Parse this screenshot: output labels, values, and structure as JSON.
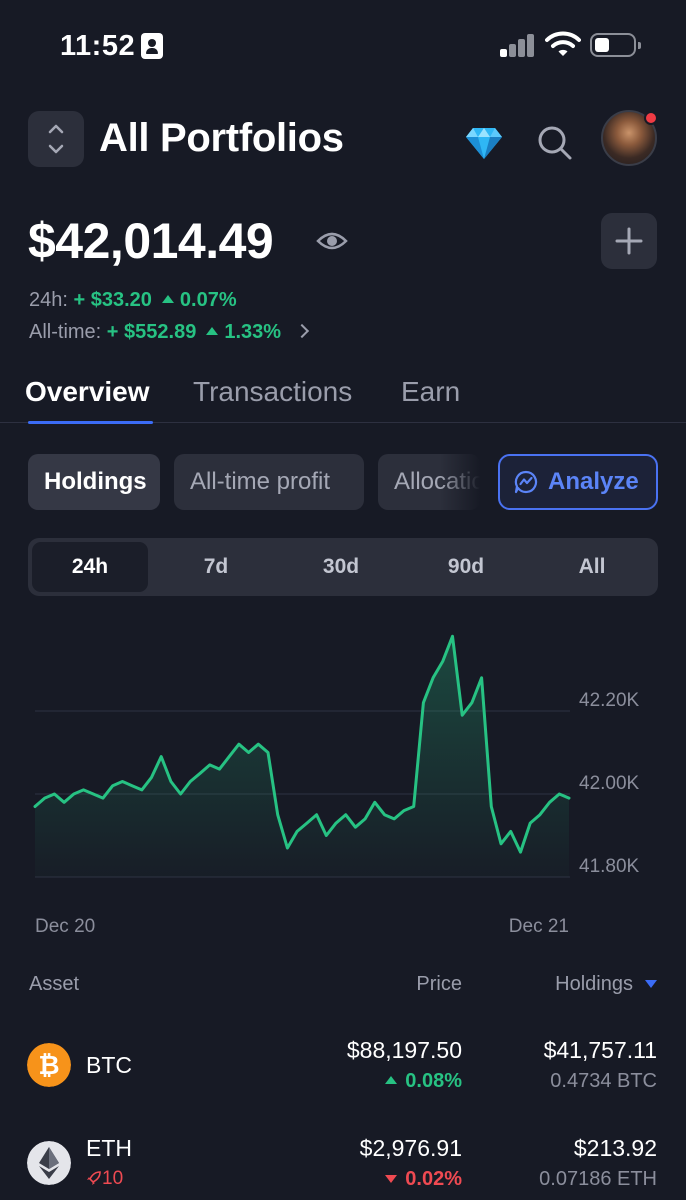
{
  "status_bar": {
    "time": "11:52"
  },
  "header": {
    "title": "All Portfolios"
  },
  "balance": {
    "amount": "$42,014.49",
    "day_label": "24h:",
    "day_change": "+ $33.20",
    "day_pct": "0.07%",
    "alltime_label": "All-time:",
    "alltime_change": "+ $552.89",
    "alltime_pct": "1.33%"
  },
  "tabs": [
    {
      "label": "Overview",
      "active": true
    },
    {
      "label": "Transactions"
    },
    {
      "label": "Earn"
    }
  ],
  "chips": {
    "holdings": "Holdings",
    "alltime_profit": "All-time profit",
    "allocation": "Allocation",
    "analyze": "Analyze"
  },
  "ranges": [
    "24h",
    "7d",
    "30d",
    "90d",
    "All"
  ],
  "selected_range": "24h",
  "chart_data": {
    "type": "line",
    "y_ticks": [
      "42.20K",
      "42.00K",
      "41.80K"
    ],
    "ylim": [
      41.8,
      42.4
    ],
    "x_tick_labels": [
      "Dec 20",
      "Dec 21"
    ],
    "series_color": "#27c283",
    "y_values": [
      41.97,
      41.99,
      42.0,
      41.98,
      42.0,
      42.01,
      42.0,
      41.99,
      42.02,
      42.03,
      42.02,
      42.01,
      42.04,
      42.09,
      42.03,
      42.0,
      42.03,
      42.05,
      42.07,
      42.06,
      42.09,
      42.12,
      42.1,
      42.12,
      42.1,
      41.95,
      41.87,
      41.91,
      41.93,
      41.95,
      41.9,
      41.93,
      41.95,
      41.92,
      41.94,
      41.98,
      41.95,
      41.94,
      41.96,
      41.97,
      42.22,
      42.28,
      42.32,
      42.38,
      42.19,
      42.22,
      42.28,
      41.97,
      41.88,
      41.91,
      41.86,
      41.93,
      41.95,
      41.98,
      42.0,
      41.99
    ]
  },
  "table": {
    "headers": {
      "asset": "Asset",
      "price": "Price",
      "holdings": "Holdings"
    },
    "rows": [
      {
        "symbol": "BTC",
        "price": "$88,197.50",
        "change": "0.08%",
        "direction": "up",
        "value": "$41,757.11",
        "quantity": "0.4734 BTC",
        "icon": "bitcoin-icon"
      },
      {
        "symbol": "ETH",
        "boost": "10",
        "price": "$2,976.91",
        "change": "0.02%",
        "direction": "down",
        "value": "$213.92",
        "quantity": "0.07186 ETH",
        "icon": "ethereum-icon"
      }
    ]
  },
  "colors": {
    "accent": "#3b6cf6",
    "positive": "#27c283",
    "negative": "#ef4a52",
    "background": "#171a25"
  }
}
